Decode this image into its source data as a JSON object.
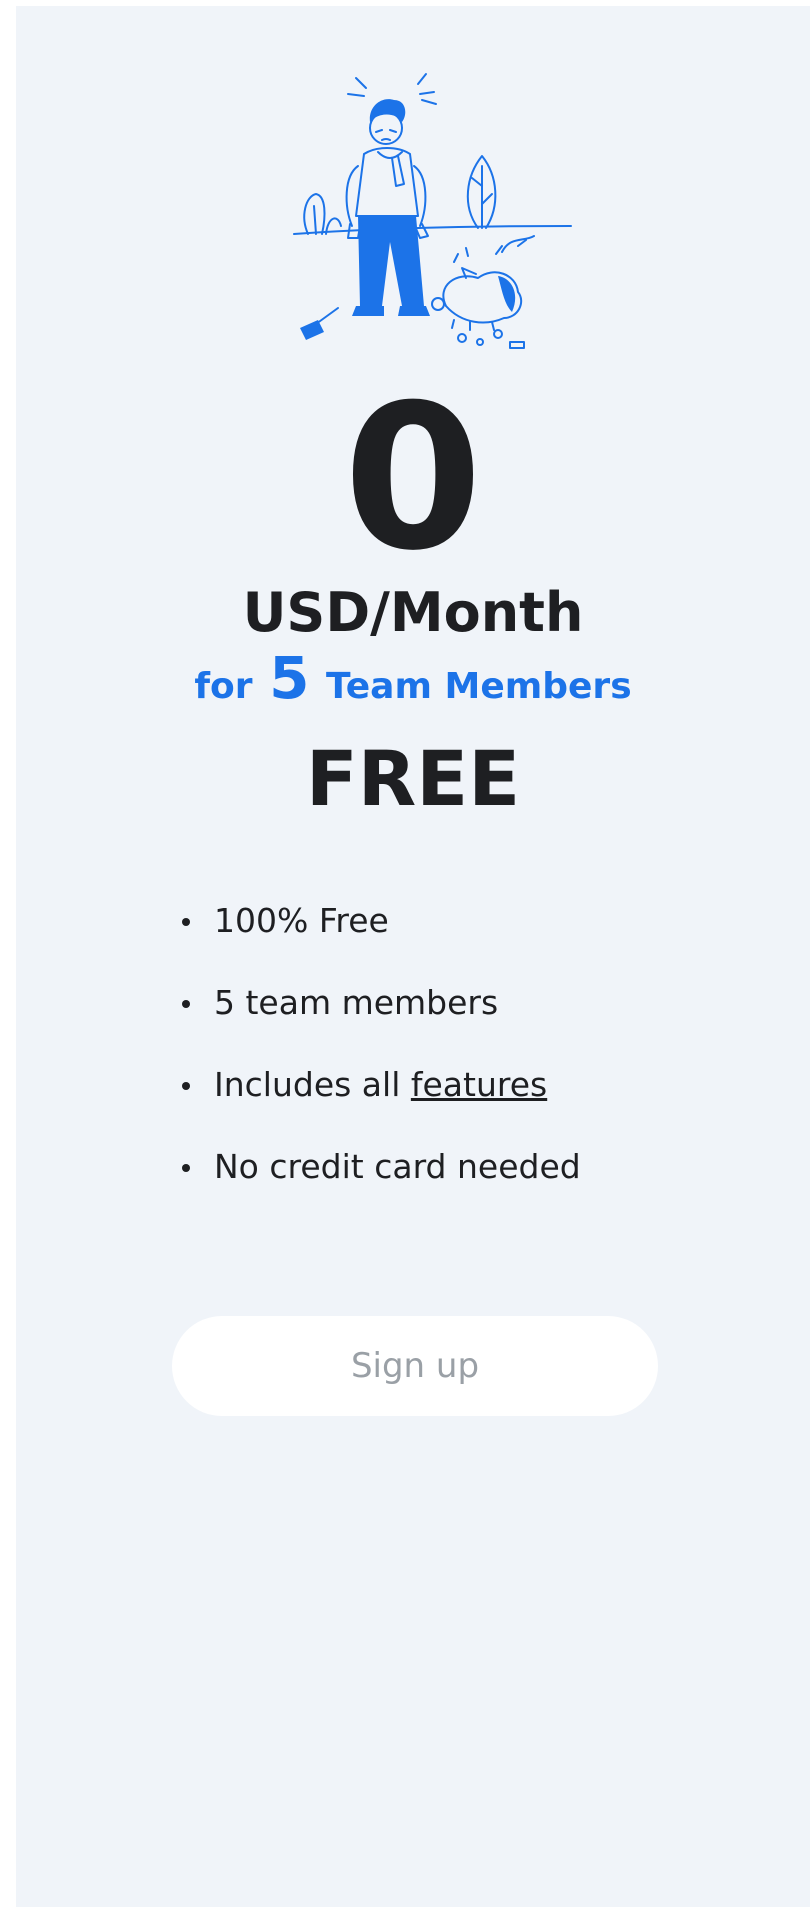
{
  "pricing": {
    "price": "0",
    "unit": "USD/Month",
    "members_prefix": "for",
    "members_count": "5",
    "members_suffix": "Team Members",
    "plan_name": "FREE"
  },
  "features": [
    {
      "text": "100% Free"
    },
    {
      "text": "5 team members"
    },
    {
      "text": "Includes all ",
      "link": "features"
    },
    {
      "text": "No credit card needed"
    }
  ],
  "actions": {
    "signup_label": "Sign up"
  },
  "colors": {
    "accent": "#1c73e8",
    "text": "#1e1f22",
    "background": "#f0f4f9",
    "button_text": "#9aa0a6"
  }
}
